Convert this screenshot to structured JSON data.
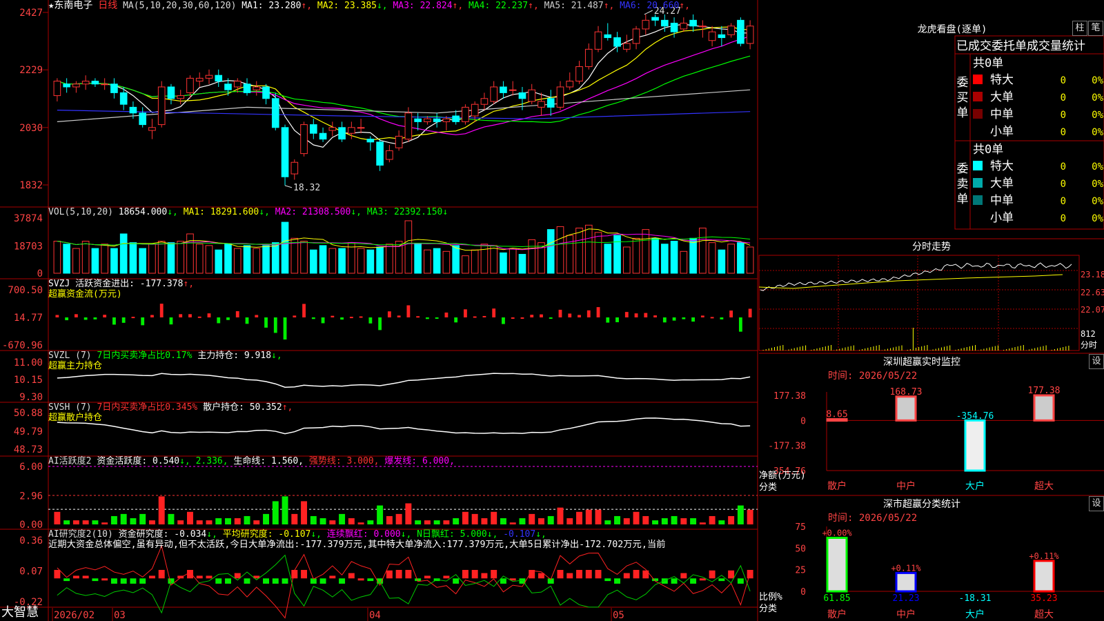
{
  "stock": {
    "name": "★东南电子",
    "period": "日线"
  },
  "ma_header": {
    "label": "MA(5,10,20,30,60,120)",
    "items": [
      {
        "text": "MA1: 23.280",
        "arrow": "↑",
        "color": "#ffffff"
      },
      {
        "text": "MA2: 23.385",
        "arrow": "↓",
        "color": "#ffff00"
      },
      {
        "text": "MA3: 22.824",
        "arrow": "↑",
        "color": "#ff00ff"
      },
      {
        "text": "MA4: 22.237",
        "arrow": "↑",
        "color": "#00ff00"
      },
      {
        "text": "MA5: 21.487",
        "arrow": "↑",
        "color": "#cccccc"
      },
      {
        "text": "MA6: 20.660",
        "arrow": "↑",
        "color": "#3333ff"
      }
    ]
  },
  "price_axis": [
    "2427",
    "2229",
    "2030",
    "1832"
  ],
  "price_annotations": {
    "high": "24.27",
    "low": "18.32"
  },
  "vol_header": {
    "label": "VOL(5,10,20)",
    "value": "18654.000",
    "ma1": "MA1: 18291.600",
    "ma2": "MA2: 21308.500",
    "ma3": "MA3: 22392.150"
  },
  "vol_axis": [
    "37874",
    "18703",
    "0"
  ],
  "svzj_header": {
    "label": "SVZJ  活跃资金进出: -177.378",
    "sub": "超赢资金流(万元)"
  },
  "svzj_axis": [
    "700.50",
    "14.77",
    "-670.96"
  ],
  "svzl_header": {
    "label": "SVZL (7)",
    "pct": "7日内买卖净占比0.17%",
    "hold": "主力持仓: 9.918",
    "sub": "超赢主力持仓"
  },
  "svzl_axis": [
    "11.00",
    "10.15",
    "9.30"
  ],
  "svsh_header": {
    "label": "SVSH (7)",
    "pct": "7日内买卖净占比0.345%",
    "hold": "散户持仓: 50.352",
    "sub": "超赢散户持仓"
  },
  "svsh_axis": [
    "50.88",
    "49.79",
    "48.73"
  ],
  "ai1_header": {
    "label": "AI活跃度2",
    "a": "资金活跃度: 0.540",
    "b": "2.336,",
    "c": "生命线: 1.560,",
    "d": "强势线: 3.000,",
    "e": "爆发线: 6.000,"
  },
  "ai1_axis": [
    "6.00",
    "2.96",
    "0.00"
  ],
  "ai2_header": {
    "label": "AI研究度2(10)",
    "a": "资金研究度: -0.034",
    "b": "平均研究度: -0.107",
    "c": "连续飘红: 0.000",
    "d": "N日飘红: 5.000",
    "e": "-0.107"
  },
  "ai2_comment": "近期大资金总体偏空,虽有异动,但不太活跃,今日大单净流出:-177.379万元,其中特大单净流入:177.379万元,大单5日累计净出-172.702万元,当前",
  "ai2_axis": [
    "0.36",
    "0.07",
    "-0.22"
  ],
  "bottom_bar": {
    "logo": "大智慧",
    "dates": [
      "2026/02",
      "03",
      "04",
      "05"
    ]
  },
  "right_panel": {
    "dragon_title": "龙虎看盘(逐单)",
    "btn_bar": "柱",
    "btn_pen": "笔",
    "tabs": [
      "已成交",
      "委托单",
      "成交量统计"
    ],
    "buy_label": "委买单",
    "sell_label": "委卖单",
    "buy_total": "共0单",
    "sell_total": "共0单",
    "buy_rows": [
      {
        "label": "特大",
        "value": "0",
        "pct": "0%",
        "color": "#ff0000"
      },
      {
        "label": "大单",
        "value": "0",
        "pct": "0%",
        "color": "#aa0000"
      },
      {
        "label": "中单",
        "value": "0",
        "pct": "0%",
        "color": "#770000"
      },
      {
        "label": "小单",
        "value": "0",
        "pct": "0%",
        "color": "#000000"
      }
    ],
    "sell_rows": [
      {
        "label": "特大",
        "value": "0",
        "pct": "0%",
        "color": "#00ffff"
      },
      {
        "label": "大单",
        "value": "0",
        "pct": "0%",
        "color": "#00aaaa"
      },
      {
        "label": "中单",
        "value": "0",
        "pct": "0%",
        "color": "#007777"
      },
      {
        "label": "小单",
        "value": "0",
        "pct": "0%",
        "color": "#000000"
      }
    ],
    "timeshare_title": "分时走势",
    "timeshare_axis": [
      "23.18",
      "22.63",
      "22.07",
      "812",
      "分时"
    ],
    "sz_title": "深圳超赢实时监控",
    "sz_time": "时间: 2026/05/22",
    "sz_axis": [
      "177.38",
      "0",
      "-177.38",
      "-354.76"
    ],
    "sz_ylabel": "净额(万元)",
    "sz_xlabel": "分类",
    "sz_bars": [
      {
        "cat": "散户",
        "value": 8.65,
        "label": "8.65"
      },
      {
        "cat": "中户",
        "value": 168.73,
        "label": "168.73"
      },
      {
        "cat": "大户",
        "value": -354.76,
        "label": "-354.76"
      },
      {
        "cat": "超大",
        "value": 177.38,
        "label": "177.38"
      }
    ],
    "cls_title": "深市超赢分类统计",
    "cls_time": "时间: 2026/05/22",
    "cls_axis": [
      "75",
      "50",
      "25",
      "0"
    ],
    "cls_ylabel": "比例%",
    "cls_xlabel": "分类",
    "cls_bars": [
      {
        "cat": "散户",
        "value": 61.85,
        "top": "+0.00%",
        "bottom": "61.85",
        "color": "#00ff00"
      },
      {
        "cat": "中户",
        "value": 21.23,
        "top": "+0.11%",
        "bottom": "21.23",
        "color": "#0000ff"
      },
      {
        "cat": "大户",
        "value": 0,
        "top": "",
        "bottom": "-18.31",
        "color": "#00ffff"
      },
      {
        "cat": "超大",
        "value": 35.23,
        "top": "+0.11%",
        "bottom": "35.23",
        "color": "#ff0000"
      }
    ],
    "settings_btn": "设",
    "settings_btn2": "设"
  },
  "chart_data": {
    "type": "candlestick",
    "ma_colors": [
      "#ffffff",
      "#ffff00",
      "#ff00ff",
      "#00ff00",
      "#cccccc",
      "#3333ff"
    ],
    "candles": [
      [
        21.4,
        21.9,
        22.0,
        21.2
      ],
      [
        21.8,
        21.7,
        22.0,
        21.5
      ],
      [
        21.7,
        21.8,
        21.9,
        21.5
      ],
      [
        21.8,
        21.9,
        22.1,
        21.6
      ],
      [
        21.9,
        21.8,
        22.0,
        21.7
      ],
      [
        21.8,
        21.8,
        22.0,
        21.6
      ],
      [
        21.8,
        21.5,
        22.0,
        21.3
      ],
      [
        21.5,
        21.1,
        21.7,
        20.9
      ],
      [
        21.0,
        20.8,
        21.2,
        20.6
      ],
      [
        20.8,
        20.4,
        21.0,
        20.3
      ],
      [
        20.2,
        20.3,
        20.6,
        19.9
      ],
      [
        20.4,
        21.7,
        21.9,
        20.3
      ],
      [
        21.7,
        21.3,
        21.8,
        21.1
      ],
      [
        21.3,
        21.4,
        21.6,
        21.1
      ],
      [
        21.5,
        22.0,
        22.1,
        21.3
      ],
      [
        21.9,
        22.0,
        22.2,
        21.7
      ],
      [
        22.0,
        22.1,
        22.3,
        21.8
      ],
      [
        22.1,
        21.9,
        22.3,
        21.7
      ],
      [
        21.8,
        21.6,
        22.0,
        21.4
      ],
      [
        21.7,
        21.9,
        22.0,
        21.5
      ],
      [
        21.8,
        21.5,
        22.0,
        21.4
      ],
      [
        21.6,
        21.7,
        21.9,
        21.4
      ],
      [
        21.7,
        21.3,
        21.8,
        21.1
      ],
      [
        21.3,
        20.3,
        21.5,
        20.2
      ],
      [
        20.3,
        18.6,
        20.4,
        18.3
      ],
      [
        18.7,
        19.1,
        19.2,
        18.5
      ],
      [
        19.4,
        20.4,
        20.5,
        19.3
      ],
      [
        20.4,
        20.1,
        20.6,
        19.9
      ],
      [
        20.1,
        19.9,
        20.3,
        19.8
      ],
      [
        20.2,
        20.3,
        20.5,
        20.0
      ],
      [
        20.3,
        19.9,
        20.5,
        19.8
      ],
      [
        20.1,
        20.3,
        20.5,
        19.9
      ],
      [
        20.3,
        20.3,
        20.6,
        20.1
      ],
      [
        19.9,
        19.8,
        20.0,
        19.5
      ],
      [
        19.8,
        19.0,
        19.9,
        18.8
      ],
      [
        19.2,
        19.5,
        19.7,
        19.1
      ],
      [
        19.6,
        20.0,
        20.2,
        19.5
      ],
      [
        19.9,
        20.8,
        21.0,
        19.8
      ],
      [
        20.6,
        20.5,
        20.8,
        20.2
      ],
      [
        20.5,
        20.6,
        20.7,
        20.4
      ],
      [
        20.6,
        20.5,
        20.8,
        20.3
      ],
      [
        20.5,
        20.6,
        20.7,
        20.2
      ],
      [
        20.7,
        20.5,
        20.9,
        20.4
      ],
      [
        20.5,
        21.0,
        21.1,
        20.4
      ],
      [
        20.7,
        21.1,
        21.2,
        20.5
      ],
      [
        21.1,
        21.3,
        21.5,
        20.9
      ],
      [
        21.2,
        21.7,
        21.9,
        21.1
      ],
      [
        21.7,
        21.5,
        21.9,
        21.3
      ],
      [
        21.6,
        21.6,
        21.9,
        21.4
      ],
      [
        21.5,
        21.3,
        21.7,
        20.9
      ],
      [
        21.2,
        21.6,
        21.8,
        21.1
      ],
      [
        21.0,
        21.2,
        21.5,
        20.7
      ],
      [
        21.3,
        21.0,
        21.6,
        20.7
      ],
      [
        21.0,
        21.7,
        21.9,
        20.9
      ],
      [
        21.7,
        21.9,
        22.2,
        21.6
      ],
      [
        21.9,
        22.4,
        22.6,
        21.8
      ],
      [
        22.4,
        23.0,
        23.2,
        22.3
      ],
      [
        23.0,
        23.6,
        23.8,
        22.9
      ],
      [
        23.5,
        23.4,
        23.9,
        23.3
      ],
      [
        23.4,
        23.1,
        23.6,
        22.9
      ],
      [
        23.0,
        23.2,
        23.5,
        22.9
      ],
      [
        23.2,
        23.7,
        23.8,
        23.0
      ],
      [
        23.7,
        24.0,
        24.2,
        23.5
      ],
      [
        24.1,
        24.0,
        24.2,
        23.8
      ],
      [
        24.0,
        23.8,
        24.2,
        23.6
      ],
      [
        23.9,
        23.6,
        24.1,
        23.4
      ],
      [
        23.7,
        23.9,
        24.1,
        23.6
      ],
      [
        24.0,
        23.8,
        24.2,
        23.6
      ],
      [
        23.8,
        23.8,
        24.0,
        23.4
      ],
      [
        23.3,
        23.6,
        23.8,
        23.1
      ],
      [
        23.5,
        23.4,
        23.8,
        23.1
      ],
      [
        23.5,
        23.8,
        23.9,
        23.4
      ],
      [
        24.0,
        23.2,
        24.1,
        23.1
      ],
      [
        23.2,
        23.8,
        24.0,
        23.0
      ]
    ],
    "volume": [
      22000,
      20000,
      17000,
      22000,
      17000,
      20000,
      17000,
      27000,
      21000,
      17000,
      20000,
      22000,
      21000,
      22000,
      27000,
      20000,
      19000,
      16000,
      20000,
      17000,
      19000,
      17000,
      19000,
      21000,
      35000,
      24000,
      22000,
      16000,
      19000,
      17000,
      17000,
      21000,
      17000,
      16000,
      18000,
      20000,
      22000,
      36000,
      20000,
      16000,
      17000,
      15000,
      19000,
      12000,
      16000,
      20000,
      19000,
      14000,
      17000,
      13000,
      23000,
      21000,
      30000,
      32000,
      26000,
      31000,
      33000,
      28000,
      20000,
      26000,
      18000,
      24000,
      30000,
      24000,
      20000,
      22000,
      15000,
      24000,
      31000,
      21000,
      16000,
      20000,
      21000,
      18000
    ],
    "title": "",
    "xlabel": "",
    "ylabel": ""
  }
}
